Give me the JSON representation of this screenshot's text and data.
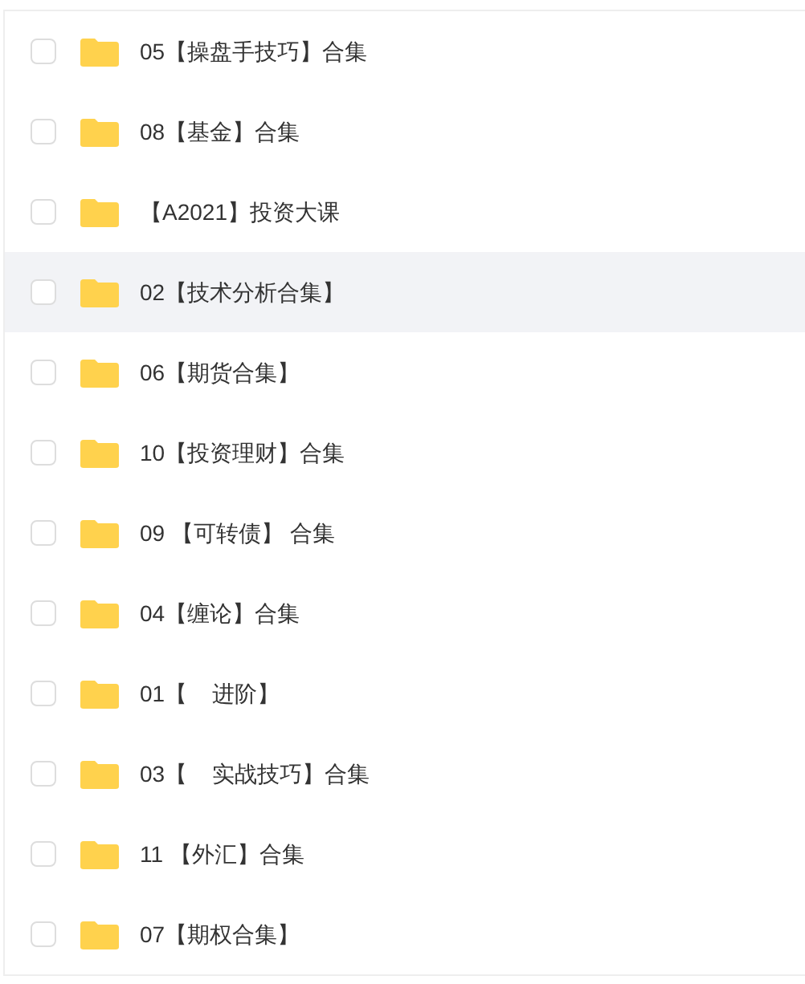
{
  "files": [
    {
      "name": "05【操盘手技巧】合集",
      "checked": false,
      "highlighted": false
    },
    {
      "name": "08【基金】合集",
      "checked": false,
      "highlighted": false
    },
    {
      "name": "【A2021】投资大课",
      "checked": false,
      "highlighted": false
    },
    {
      "name": "02【技术分析合集】",
      "checked": false,
      "highlighted": true
    },
    {
      "name": "06【期货合集】",
      "checked": false,
      "highlighted": false
    },
    {
      "name": "10【投资理财】合集",
      "checked": false,
      "highlighted": false
    },
    {
      "name": "09 【可转债】 合集",
      "checked": false,
      "highlighted": false
    },
    {
      "name": "04【缠论】合集",
      "checked": false,
      "highlighted": false
    },
    {
      "name": "01【    进阶】",
      "checked": false,
      "highlighted": false
    },
    {
      "name": "03【    实战技巧】合集",
      "checked": false,
      "highlighted": false
    },
    {
      "name": "11 【外汇】合集",
      "checked": false,
      "highlighted": false
    },
    {
      "name": "07【期权合集】",
      "checked": false,
      "highlighted": false
    }
  ]
}
